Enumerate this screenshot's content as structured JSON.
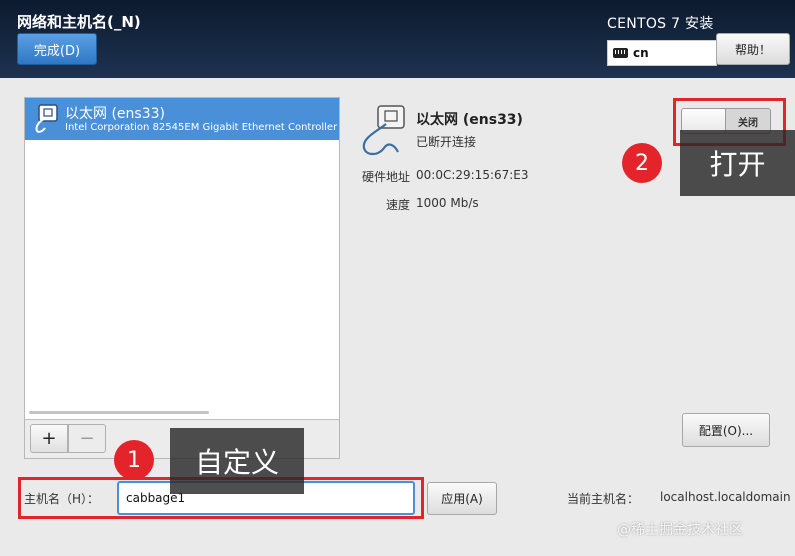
{
  "header": {
    "title": "网络和主机名(_N)",
    "done_label": "完成(D)",
    "install_title": "CENTOS 7 安装",
    "keyboard_layout": "cn",
    "help_label": "帮助！"
  },
  "device_list": {
    "items": [
      {
        "name": "以太网 (ens33)",
        "description": "Intel Corporation 82545EM Gigabit Ethernet Controller (C",
        "selected": true
      }
    ],
    "add_label": "+",
    "remove_label": "−"
  },
  "device_detail": {
    "name": "以太网 (ens33)",
    "status": "已断开连接",
    "hw_address_label": "硬件地址",
    "hw_address": "00:0C:29:15:67:E3",
    "speed_label": "速度",
    "speed": "1000 Mb/s",
    "toggle_label": "关闭",
    "configure_label": "配置(O)..."
  },
  "hostname": {
    "label": "主机名（H）：",
    "value": "cabbage1",
    "apply_label": "应用(A)",
    "current_label": "当前主机名：",
    "current_value": "localhost.localdomain"
  },
  "annotations": {
    "step1_number": "1",
    "step1_text": "自定义",
    "step2_number": "2",
    "step2_text": "打开",
    "color": "#e3242b"
  },
  "watermark": "@稀土掘金技术社区",
  "colors": {
    "header_bg": "#0c1a2e",
    "accent": "#4a90d9",
    "done_button": "#3d86d0"
  }
}
